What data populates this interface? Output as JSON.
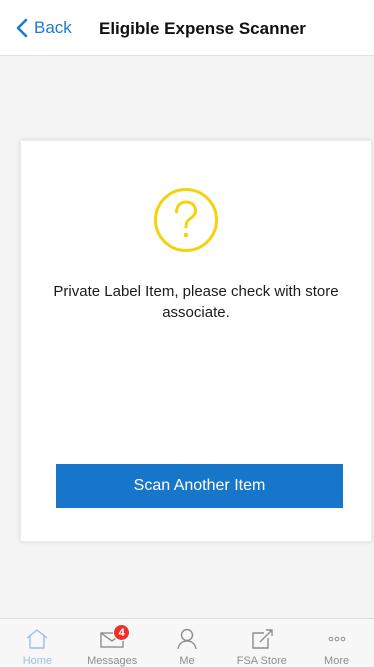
{
  "header": {
    "back_label": "Back",
    "title": "Eligible Expense Scanner"
  },
  "result": {
    "icon": "question-circle-icon",
    "icon_color": "#f5d20f",
    "message": "Private Label Item, please check with store associate.",
    "scan_button_label": "Scan Another Item"
  },
  "colors": {
    "accent": "#1776c9",
    "badge": "#e8322a"
  },
  "tabbar": {
    "items": [
      {
        "label": "Home",
        "icon": "house-icon",
        "active": true
      },
      {
        "label": "Messages",
        "icon": "envelope-icon",
        "badge": "4"
      },
      {
        "label": "Me",
        "icon": "person-icon"
      },
      {
        "label": "FSA Store",
        "icon": "external-link-icon"
      },
      {
        "label": "More",
        "icon": "more-dots-icon"
      }
    ]
  }
}
